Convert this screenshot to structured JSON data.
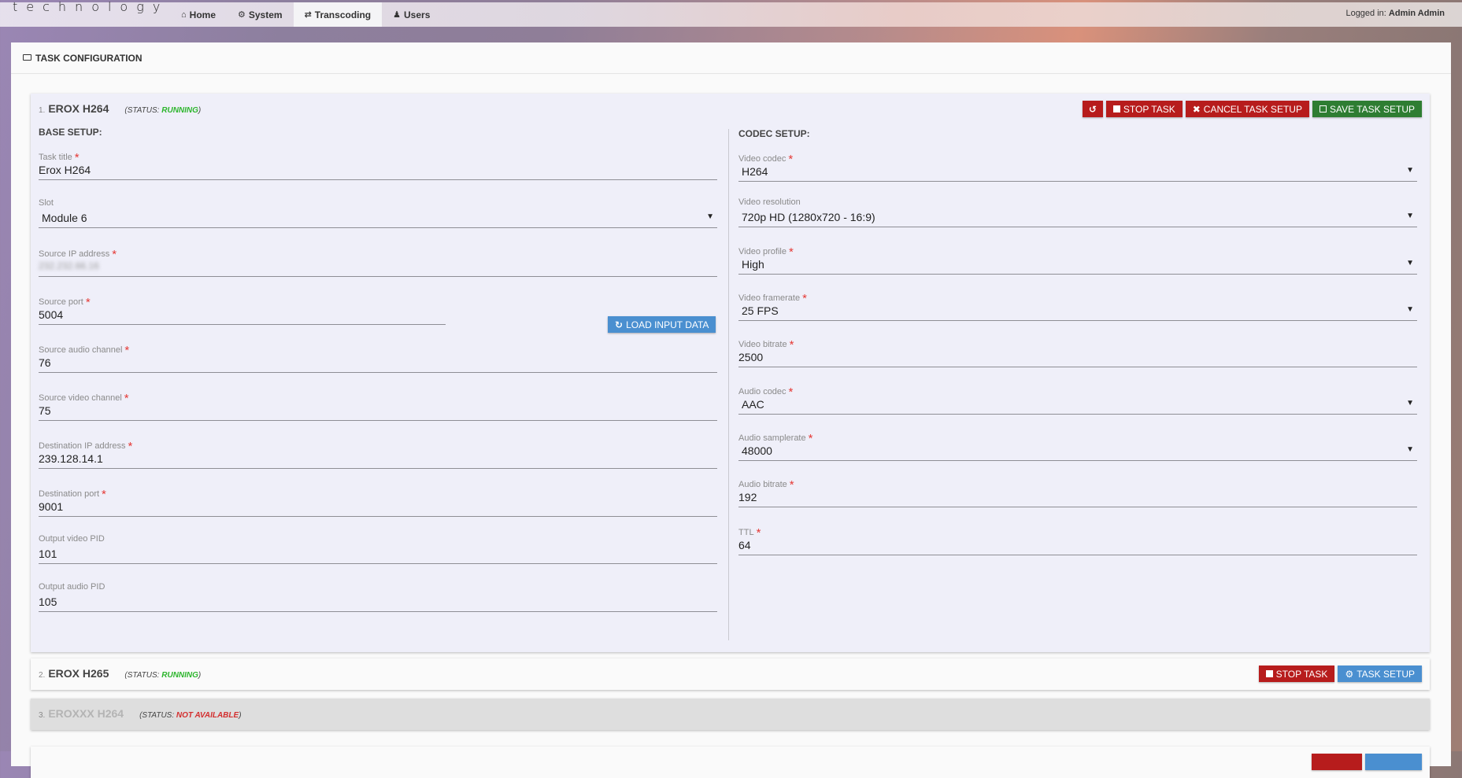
{
  "header": {
    "brand": "technology",
    "nav": [
      {
        "icon": "home-icon",
        "glyph": "🏠",
        "label": "Home",
        "active": false
      },
      {
        "icon": "cogs-icon",
        "glyph": "⚙",
        "label": "System",
        "active": false
      },
      {
        "icon": "exchange-icon",
        "glyph": "⇄",
        "label": "Transcoding",
        "active": true
      },
      {
        "icon": "user-icon",
        "glyph": "👤",
        "label": "Users",
        "active": false
      }
    ],
    "login_label": "Logged in:",
    "login_user": "Admin Admin"
  },
  "panel": {
    "title": "TASK CONFIGURATION"
  },
  "tasks": [
    {
      "number": "1.",
      "name": "EROX H264",
      "status_prefix": "(STATUS: ",
      "status": "RUNNING",
      "status_suffix": ")",
      "buttons": {
        "restart_glyph": "↺",
        "stop": "STOP TASK",
        "cancel": "CANCEL TASK SETUP",
        "save": "SAVE TASK SETUP"
      },
      "base_setup": {
        "title": "BASE SETUP:",
        "task_title": {
          "label": "Task title",
          "value": "Erox H264",
          "required": true
        },
        "slot": {
          "label": "Slot",
          "value": "Module 6"
        },
        "source_ip": {
          "label": "Source IP address",
          "value": "232.232.66.16",
          "required": true,
          "blurred": true
        },
        "source_port": {
          "label": "Source port",
          "value": "5004",
          "required": true
        },
        "load_input": "LOAD INPUT DATA",
        "source_audio_channel": {
          "label": "Source audio channel",
          "value": "76",
          "required": true
        },
        "source_video_channel": {
          "label": "Source video channel",
          "value": "75",
          "required": true
        },
        "destination_ip": {
          "label": "Destination IP address",
          "value": "239.128.14.1",
          "required": true
        },
        "destination_port": {
          "label": "Destination port",
          "value": "9001",
          "required": true
        },
        "output_video_pid": {
          "label": "Output video PID",
          "value": "101"
        },
        "output_audio_pid": {
          "label": "Output audio PID",
          "value": "105"
        }
      },
      "codec_setup": {
        "title": "CODEC SETUP:",
        "video_codec": {
          "label": "Video codec",
          "value": "H264",
          "required": true
        },
        "video_resolution": {
          "label": "Video resolution",
          "value": "720p HD (1280x720 - 16:9)"
        },
        "video_profile": {
          "label": "Video profile",
          "value": "High",
          "required": true
        },
        "video_framerate": {
          "label": "Video framerate",
          "value": "25 FPS",
          "required": true
        },
        "video_bitrate": {
          "label": "Video bitrate",
          "value": "2500",
          "required": true
        },
        "audio_codec": {
          "label": "Audio codec",
          "value": "AAC",
          "required": true
        },
        "audio_samplerate": {
          "label": "Audio samplerate",
          "value": "48000",
          "required": true
        },
        "audio_bitrate": {
          "label": "Audio bitrate",
          "value": "192",
          "required": true
        },
        "ttl": {
          "label": "TTL",
          "value": "64",
          "required": true
        }
      }
    },
    {
      "number": "2.",
      "name": "EROX H265",
      "status_prefix": "(STATUS: ",
      "status": "RUNNING",
      "status_suffix": ")",
      "buttons": {
        "stop": "STOP TASK",
        "setup": "TASK SETUP"
      }
    },
    {
      "number": "3.",
      "name": "EROXXX H264",
      "status_prefix": "(STATUS: ",
      "status": "NOT AVAILABLE",
      "status_suffix": ")"
    }
  ],
  "colors": {
    "running": "#2db52d",
    "not_available": "#d32f2f",
    "danger": "#b71c1c",
    "success": "#2e7d32",
    "info": "#4a8fd0"
  }
}
